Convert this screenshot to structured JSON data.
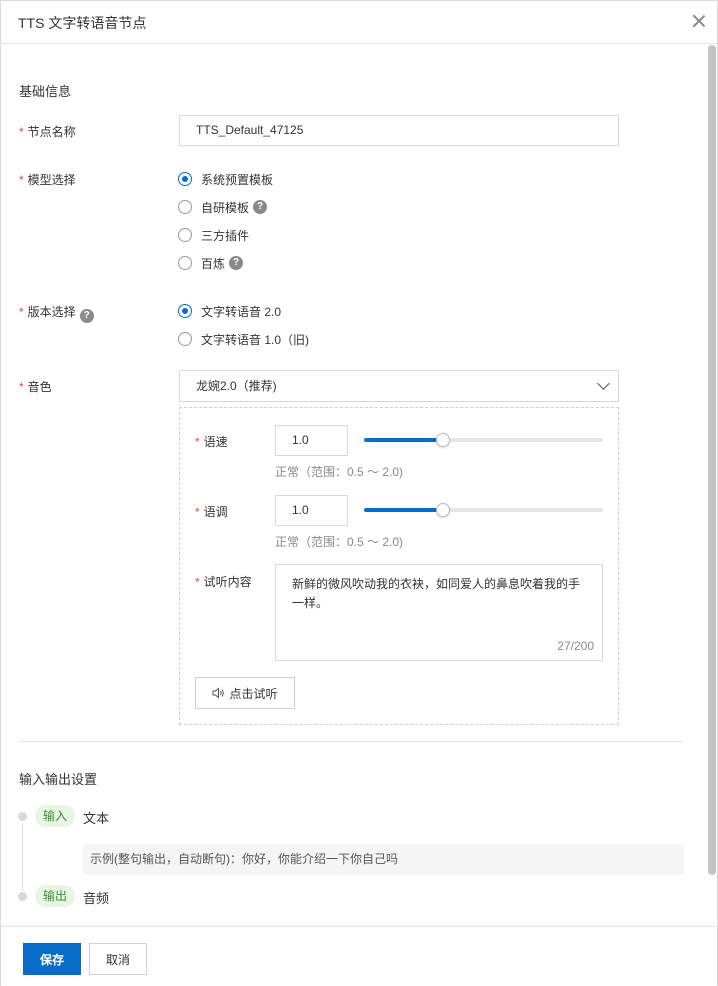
{
  "header": {
    "title": "TTS 文字转语音节点"
  },
  "basic": {
    "section_title": "基础信息"
  },
  "node_name": {
    "label": "节点名称",
    "value": "TTS_Default_47125"
  },
  "model": {
    "label": "模型选择",
    "options": [
      "系统预置模板",
      "自研模板",
      "三方插件",
      "百炼"
    ],
    "selected": "系统预置模板"
  },
  "version": {
    "label": "版本选择",
    "options": [
      "文字转语音 2.0",
      "文字转语音 1.0（旧)"
    ],
    "selected": "文字转语音 2.0"
  },
  "voice": {
    "label": "音色",
    "selected": "龙婉2.0（推荐)",
    "speed": {
      "label": "语速",
      "value": "1.0",
      "hint": "正常（范围：0.5 ～ 2.0)",
      "slider_fraction": 0.33
    },
    "pitch": {
      "label": "语调",
      "value": "1.0",
      "hint": "正常（范围：0.5 ～ 2.0)",
      "slider_fraction": 0.33
    },
    "preview": {
      "label": "试听内容",
      "text": "新鲜的微风吹动我的衣袂，如同爱人的鼻息吹着我的手一样。",
      "counter": "27/200"
    },
    "listen_button": "点击试听"
  },
  "io": {
    "section_title": "输入输出设置",
    "input": {
      "tag": "输入",
      "type": "文本",
      "example": "示例(整句输出，自动断句)：你好，你能介绍一下你自己吗"
    },
    "output": {
      "tag": "输出",
      "type": "音频"
    }
  },
  "footer": {
    "save": "保存",
    "cancel": "取消"
  },
  "colors": {
    "primary": "#0a6cc9",
    "required": "#e84a3c",
    "tag_bg": "#e8f5e4",
    "tag_text": "#3a8d2f"
  }
}
